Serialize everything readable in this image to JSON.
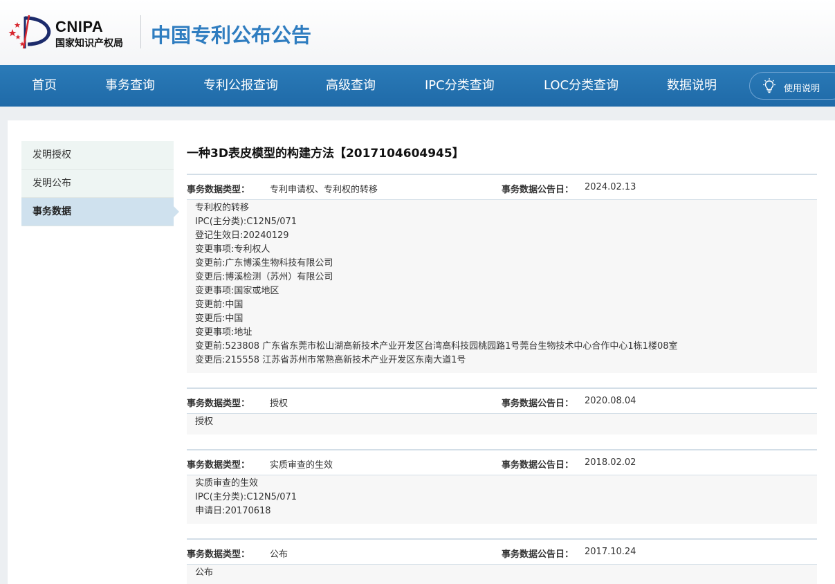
{
  "header": {
    "logo_en": "CNIPA",
    "logo_cn": "国家知识产权局",
    "site_title": "中国专利公布公告"
  },
  "nav": {
    "items": [
      "首页",
      "事务查询",
      "专利公报查询",
      "高级查询",
      "IPC分类查询",
      "LOC分类查询",
      "数据说明"
    ],
    "help_label": "使用说明",
    "help_icon": "lightbulb-icon"
  },
  "sidebar": {
    "items": [
      "发明授权",
      "发明公布",
      "事务数据"
    ],
    "active_index": 2
  },
  "document": {
    "title": "一种3D表皮模型的构建方法【2017104604945】"
  },
  "records": [
    {
      "type_label": "事务数据类型：",
      "type_value": "专利申请权、专利权的转移",
      "date_label": "事务数据公告日：",
      "date_value": "2024.02.13",
      "lines": [
        "专利权的转移",
        "IPC(主分类):C12N5/071",
        "登记生效日:20240129",
        "变更事项:专利权人",
        "变更前:广东博溪生物科技有限公司",
        "变更后:博溪检测（苏州）有限公司",
        "变更事项:国家或地区",
        "变更前:中国",
        "变更后:中国",
        "变更事项:地址",
        "变更前:523808 广东省东莞市松山湖高新技术产业开发区台湾高科技园桃园路1号莞台生物技术中心合作中心1栋1楼08室",
        "变更后:215558 江苏省苏州市常熟高新技术产业开发区东南大道1号"
      ]
    },
    {
      "type_label": "事务数据类型：",
      "type_value": "授权",
      "date_label": "事务数据公告日：",
      "date_value": "2020.08.04",
      "lines": [
        "授权"
      ]
    },
    {
      "type_label": "事务数据类型：",
      "type_value": "实质审查的生效",
      "date_label": "事务数据公告日：",
      "date_value": "2018.02.02",
      "lines": [
        "实质审查的生效",
        "IPC(主分类):C12N5/071",
        "申请日:20170618"
      ]
    },
    {
      "type_label": "事务数据类型：",
      "type_value": "公布",
      "date_label": "事务数据公告日：",
      "date_value": "2017.10.24",
      "lines": [
        "公布"
      ]
    }
  ],
  "colors": {
    "nav_bg": "#2473b2",
    "title_blue": "#2f7dc0",
    "sidebar_active": "#cfe1ee",
    "sidebar_bg": "#eef5f3"
  }
}
